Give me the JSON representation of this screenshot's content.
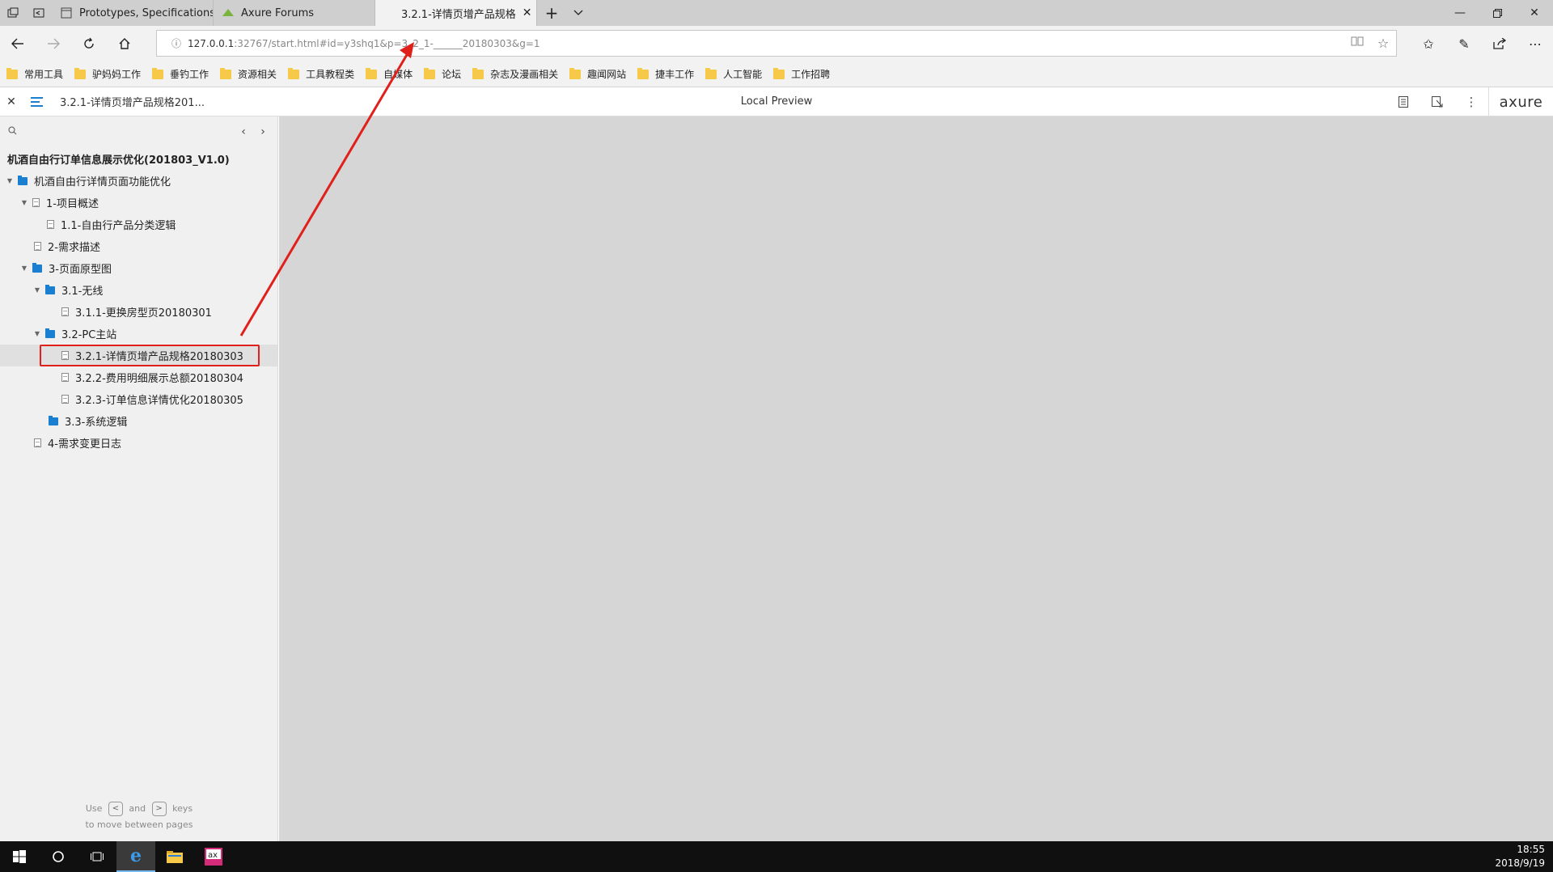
{
  "tabs": [
    {
      "title": "Prototypes, Specifications, a",
      "active": false
    },
    {
      "title": "Axure Forums",
      "active": false
    },
    {
      "title": "3.2.1-详情页增产品规格",
      "active": true
    }
  ],
  "address": {
    "host": "127.0.0.1",
    "rest": ":32767/start.html#id=y3shq1&p=3_2_1-______20180303&g=1"
  },
  "favorites": [
    "常用工具",
    "驴妈妈工作",
    "垂钓工作",
    "资源相关",
    "工具教程类",
    "自媒体",
    "论坛",
    "杂志及漫画相关",
    "趣闻网站",
    "捷丰工作",
    "人工智能",
    "工作招聘"
  ],
  "axure": {
    "page_name": "3.2.1-详情页增产品规格201...",
    "center_title": "Local Preview",
    "logo": "axure"
  },
  "sidebar": {
    "project": "机酒自由行订单信息展示优化(201803_V1.0)",
    "items": [
      {
        "label": "机酒自由行详情页面功能优化",
        "type": "folder"
      },
      {
        "label": "1-项目概述",
        "type": "page"
      },
      {
        "label": "1.1-自由行产品分类逻辑",
        "type": "page"
      },
      {
        "label": "2-需求描述",
        "type": "page"
      },
      {
        "label": "3-页面原型图",
        "type": "folder"
      },
      {
        "label": "3.1-无线",
        "type": "folder"
      },
      {
        "label": "3.1.1-更换房型页20180301",
        "type": "page"
      },
      {
        "label": "3.2-PC主站",
        "type": "folder"
      },
      {
        "label": "3.2.1-详情页增产品规格20180303",
        "type": "page",
        "selected": true
      },
      {
        "label": "3.2.2-费用明细展示总额20180304",
        "type": "page"
      },
      {
        "label": "3.2.3-订单信息详情优化20180305",
        "type": "page"
      },
      {
        "label": "3.3-系统逻辑",
        "type": "folder"
      },
      {
        "label": "4-需求变更日志",
        "type": "page"
      }
    ],
    "hint_use": "Use",
    "hint_and": "and",
    "hint_keys": "keys",
    "hint_line2": "to move between pages"
  },
  "taskbar": {
    "time": "18:55",
    "date": "2018/9/19"
  },
  "colors": {
    "accent": "#1b7fd1",
    "annotation": "#e0201b",
    "content_bg": "#d6d6d6"
  }
}
